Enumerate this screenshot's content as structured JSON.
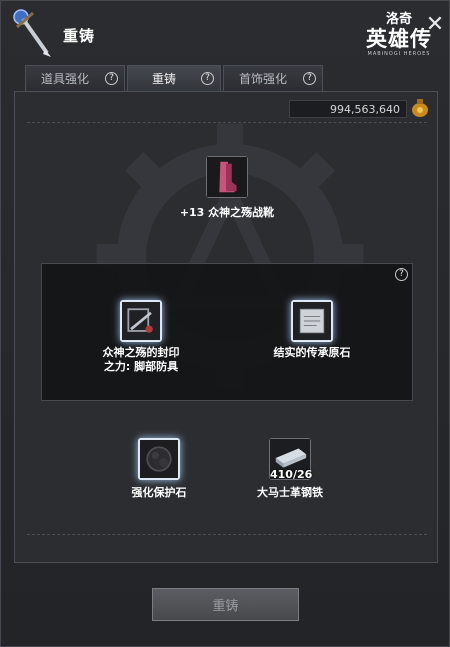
{
  "window": {
    "title": "重铸",
    "logo_top": "洛奇",
    "logo_main": "英雄传",
    "logo_sub": "MABINOGI HEROES",
    "close_symbol": "✕"
  },
  "tabs": [
    {
      "label": "道具强化",
      "active": false
    },
    {
      "label": "重铸",
      "active": true
    },
    {
      "label": "首饰强化",
      "active": false
    }
  ],
  "help_symbol": "?",
  "gold": {
    "amount": "994,563,640",
    "icon": "money-bag-icon"
  },
  "target_item": {
    "name": "+13 众神之殇战靴",
    "icon": "boots-icon"
  },
  "materials": {
    "left": {
      "label_line1": "众神之殇的封印",
      "label_line2": "之力: 脚部防具",
      "icon": "seal-scroll-icon"
    },
    "right": {
      "label": "结实的传承原石",
      "icon": "inheritance-stone-icon"
    }
  },
  "extras": {
    "left": {
      "label": "强化保护石",
      "icon": "protection-stone-icon"
    },
    "right": {
      "label": "大马士革钢铁",
      "count": "410/26",
      "icon": "steel-ingot-icon"
    }
  },
  "reforge_button": "重铸",
  "colors": {
    "glow": "#9fc2e8",
    "panel": "#2b2d31",
    "text": "#ffffff"
  }
}
